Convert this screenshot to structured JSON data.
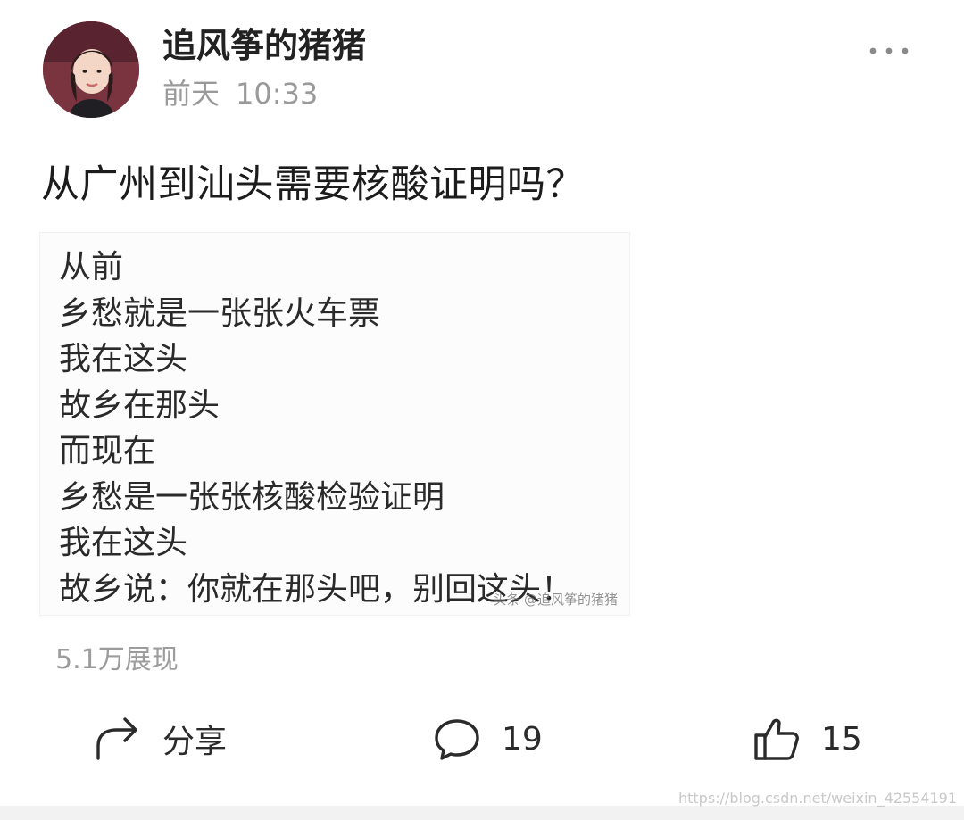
{
  "post": {
    "author_name": "追风筝的猪猪",
    "time_day": "前天",
    "time_clock": "10:33",
    "title": "从广州到汕头需要核酸证明吗？",
    "image": {
      "lines": [
        "从前",
        "乡愁就是一张张火车票",
        "我在这头",
        "故乡在那头",
        "而现在",
        "乡愁是一张张核酸检验证明",
        "我在这头",
        "故乡说：你就在那头吧，别回这头！"
      ],
      "watermark": "头条 @追风筝的猪猪"
    },
    "views": "5.1万展现"
  },
  "actions": {
    "share_label": "分享",
    "comment_count": "19",
    "like_count": "15"
  },
  "icons": {
    "more": "more-dots-icon",
    "share": "share-arrow-icon",
    "comment": "comment-bubble-icon",
    "like": "thumbs-up-icon"
  },
  "site_watermark": "https://blog.csdn.net/weixin_42554191",
  "colors": {
    "text_primary": "#1c1c1c",
    "text_secondary": "#9a9a9a",
    "icon": "#2b2b2b",
    "background": "#ffffff"
  }
}
